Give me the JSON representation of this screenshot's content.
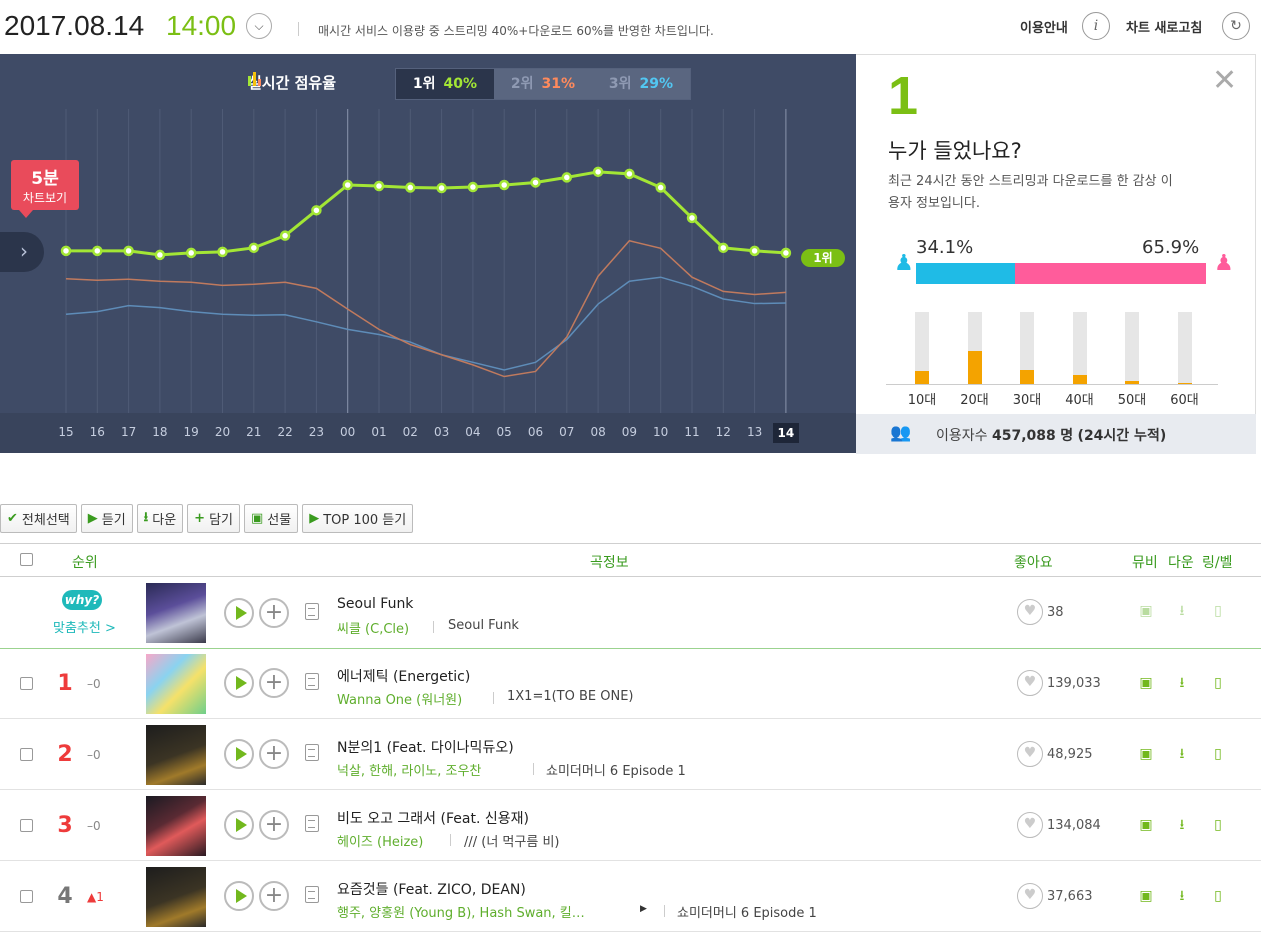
{
  "header": {
    "date": "2017.08.14",
    "time": "14:00",
    "note": "매시간 서비스 이용량 중 스트리밍 40%+다운로드 60%를 반영한 차트입니다.",
    "guide_label": "이용안내",
    "guide_icon": "i",
    "refresh_label": "차트 새로고침",
    "refresh_icon": "refresh-icon",
    "chevron_icon": "chevron-down-icon"
  },
  "chart": {
    "title": "실시간 점유율",
    "tabs": [
      {
        "label": "1위",
        "value": "40%",
        "color": "#a3e635"
      },
      {
        "label": "2위",
        "value": "31%",
        "color": "#ff8a5c"
      },
      {
        "label": "3위",
        "value": "29%",
        "color": "#52c7f2"
      }
    ],
    "five_min_top": "5분",
    "five_min_bottom": "차트보기",
    "current_rank_tag": "1위"
  },
  "chart_data": {
    "type": "line",
    "x": [
      "15",
      "16",
      "17",
      "18",
      "19",
      "20",
      "21",
      "22",
      "23",
      "00",
      "01",
      "02",
      "03",
      "04",
      "05",
      "06",
      "07",
      "08",
      "09",
      "10",
      "11",
      "12",
      "13",
      "14"
    ],
    "current_x": "14",
    "series": [
      {
        "rank": 1,
        "color": "#a3e635",
        "values": [
          42.0,
          42.0,
          42.0,
          41.2,
          41.6,
          41.8,
          42.6,
          45.0,
          50.0,
          55.0,
          54.8,
          54.5,
          54.4,
          54.6,
          55.0,
          55.5,
          56.5,
          57.6,
          57.2,
          54.5,
          48.5,
          42.6,
          42.0,
          41.6
        ]
      },
      {
        "rank": 2,
        "color": "#c07a5e",
        "values": [
          36.5,
          36.2,
          36.4,
          36.0,
          35.8,
          35.2,
          35.4,
          35.8,
          34.6,
          30.5,
          26.5,
          23.5,
          21.5,
          19.5,
          17.2,
          18.2,
          25.0,
          37.0,
          44.0,
          42.5,
          36.8,
          34.0,
          33.4,
          33.8
        ]
      },
      {
        "rank": 3,
        "color": "#5e8cb8",
        "values": [
          29.5,
          30.0,
          31.2,
          30.8,
          30.0,
          29.5,
          29.3,
          29.4,
          28.0,
          26.5,
          25.5,
          24.0,
          21.5,
          20.0,
          18.5,
          20.0,
          24.5,
          31.5,
          36.0,
          36.8,
          35.0,
          32.5,
          31.6,
          31.7
        ]
      }
    ]
  },
  "info": {
    "rank": "1",
    "heading": "누가 들었나요?",
    "desc": "최근 24시간 동안 스트리밍과 다운로드를 한 감상 이용자 정보입니다.",
    "male_pct": "34.1%",
    "female_pct": "65.9%",
    "male_fraction": 0.341,
    "age_groups": [
      {
        "label": "10대",
        "fraction": 0.18
      },
      {
        "label": "20대",
        "fraction": 0.46
      },
      {
        "label": "30대",
        "fraction": 0.2
      },
      {
        "label": "40대",
        "fraction": 0.12
      },
      {
        "label": "50대",
        "fraction": 0.04
      },
      {
        "label": "60대",
        "fraction": 0.02
      }
    ],
    "users_label": "이용자수",
    "users_value": "457,088",
    "users_unit": "명",
    "users_note": "(24시간 누적)"
  },
  "toolbar": {
    "select_all": "전체선택",
    "listen": "듣기",
    "download": "다운",
    "add": "담기",
    "gift": "선물",
    "top100": "TOP 100 듣기"
  },
  "table_header": {
    "rank": "순위",
    "info": "곡정보",
    "likes": "좋아요",
    "mv": "뮤비",
    "down": "다운",
    "ring": "링/벨"
  },
  "recommend": {
    "why": "why?",
    "label": "맞춤추천 >",
    "title": "Seoul Funk",
    "artist": "씨클 (C,Cle)",
    "album": "Seoul Funk",
    "likes": "38"
  },
  "rows": [
    {
      "rank": "1",
      "delta": "0",
      "title": "에너제틱 (Energetic)",
      "artist": "Wanna One (워너원)",
      "album": "1X1=1(TO BE ONE)",
      "likes": "139,033"
    },
    {
      "rank": "2",
      "delta": "0",
      "title": "N분의1 (Feat. 다이나믹듀오)",
      "artist": "넉살, 한해, 라이노, 조우찬",
      "album": "쇼미더머니 6 Episode 1",
      "likes": "48,925"
    },
    {
      "rank": "3",
      "delta": "0",
      "title": "비도 오고 그래서 (Feat. 신용재)",
      "artist": "헤이즈 (Heize)",
      "album": "/// (너 먹구름 비)",
      "likes": "134,084"
    },
    {
      "rank": "4",
      "delta": "1",
      "title": "요즘것들 (Feat. ZICO, DEAN)",
      "artist": "행주, 양홍원 (Young B), Hash Swan, 킬…",
      "album": "쇼미더머니 6 Episode 1",
      "likes": "37,663"
    }
  ]
}
